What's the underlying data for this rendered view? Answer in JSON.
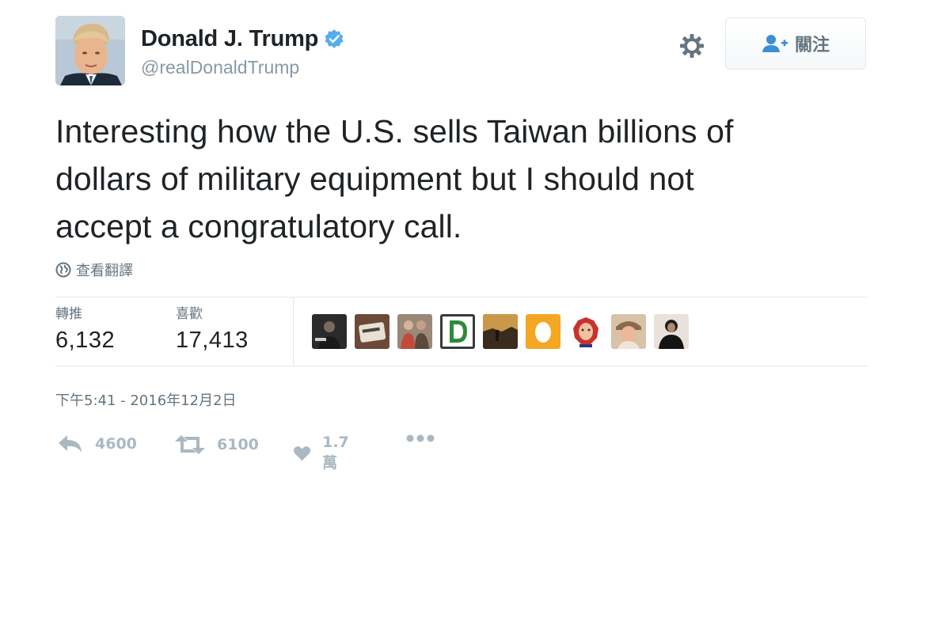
{
  "user": {
    "name": "Donald J. Trump",
    "handle": "@realDonaldTrump"
  },
  "follow_button": {
    "label": "關注"
  },
  "tweet": {
    "lines": [
      "Interesting how the U.S. sells Taiwan billions of",
      "dollars of military equipment but I should not",
      "accept a congratulatory call."
    ],
    "translate_label": "查看翻譯"
  },
  "stats": {
    "retweets_label": "轉推",
    "retweets_value": "6,132",
    "likes_label": "喜歡",
    "likes_value": "17,413"
  },
  "timestamp": "下午5:41 - 2016年12月2日",
  "actions": {
    "reply_count": "4600",
    "retweet_count": "6100",
    "like_count": "1.7萬"
  },
  "colors": {
    "verified": "#55acee",
    "muted": "#66757f",
    "action_gray": "#aab8c2",
    "text": "#1f2326"
  }
}
